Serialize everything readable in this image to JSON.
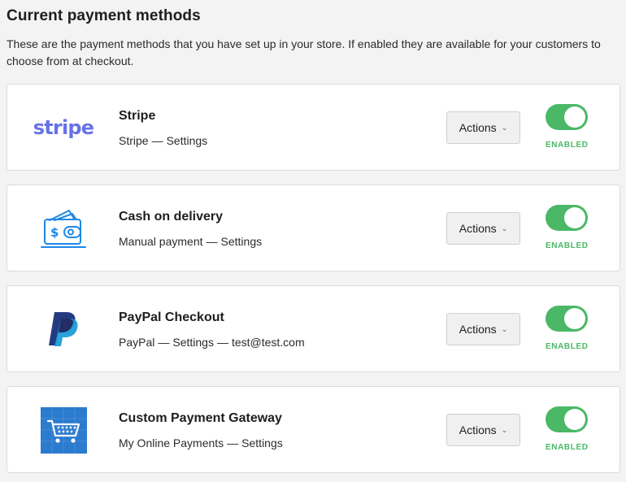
{
  "header": {
    "title": "Current payment methods",
    "description": "These are the payment methods that you have set up in your store. If enabled they are available for your customers to choose from at checkout."
  },
  "colors": {
    "enabled_green": "#4ab866",
    "stripe_purple": "#6772e5",
    "cod_blue": "#1e88e5",
    "paypal_dark": "#253b80",
    "paypal_light": "#179bd7",
    "ecwid_blue": "#2b7bcf"
  },
  "methods": [
    {
      "name": "Stripe",
      "logo_icon": "stripe-logo",
      "logo_text": "stripe",
      "provider": "Stripe",
      "settings_label": "Settings",
      "extra": "",
      "actions_label": "Actions",
      "enabled": true,
      "status_label": "ENABLED"
    },
    {
      "name": "Cash on delivery",
      "logo_icon": "wallet-cash-icon",
      "provider": "Manual payment",
      "settings_label": "Settings",
      "extra": "",
      "actions_label": "Actions",
      "enabled": true,
      "status_label": "ENABLED"
    },
    {
      "name": "PayPal Checkout",
      "logo_icon": "paypal-logo",
      "provider": "PayPal",
      "settings_label": "Settings",
      "extra": "test@test.com",
      "actions_label": "Actions",
      "enabled": true,
      "status_label": "ENABLED"
    },
    {
      "name": "Custom Payment Gateway",
      "logo_icon": "shopping-cart-logo",
      "provider": "My Online Payments",
      "settings_label": "Settings",
      "extra": "",
      "actions_label": "Actions",
      "enabled": true,
      "status_label": "ENABLED"
    }
  ]
}
